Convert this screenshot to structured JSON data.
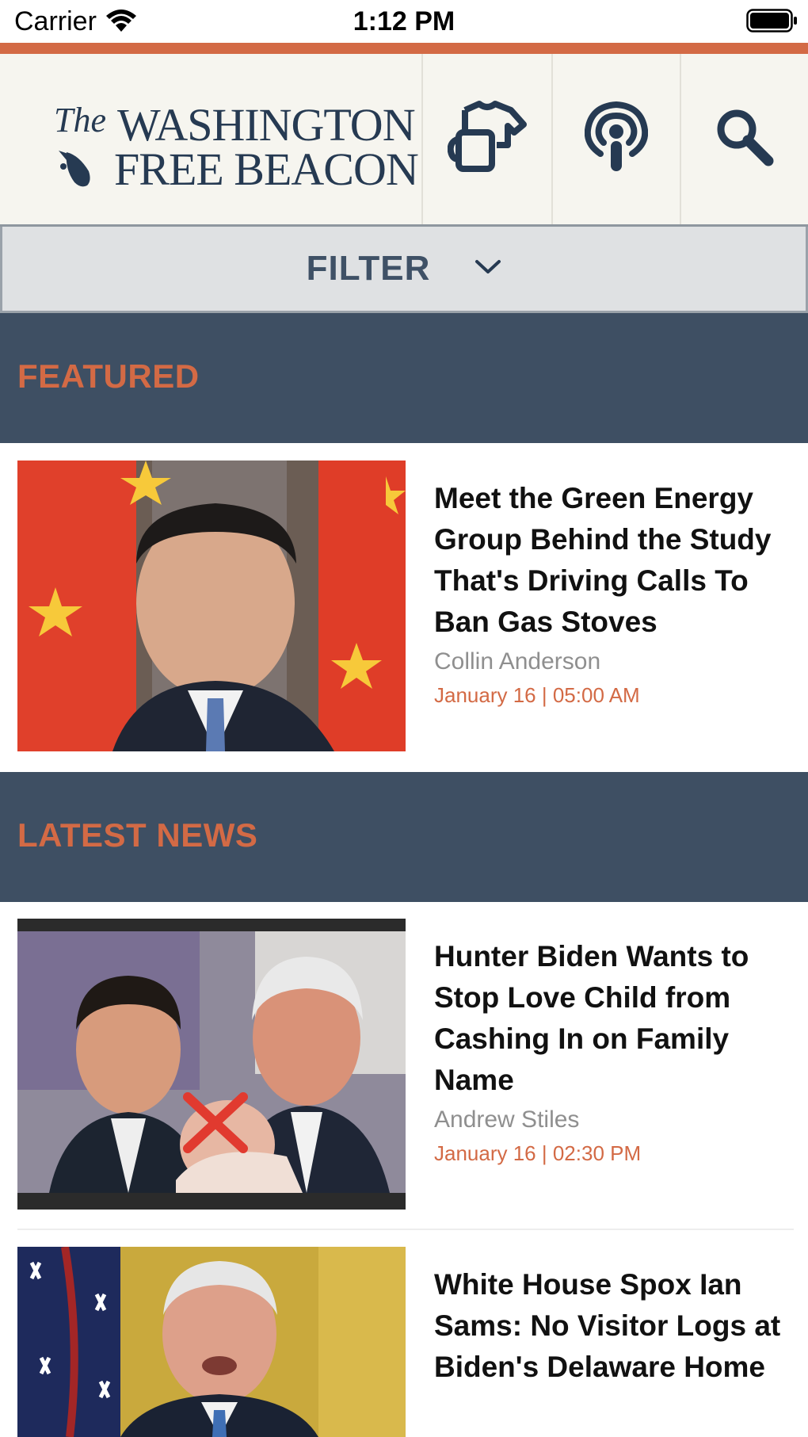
{
  "status_bar": {
    "carrier": "Carrier",
    "time": "1:12 PM",
    "wifi_icon": "wifi-icon",
    "battery_icon": "battery-icon"
  },
  "header": {
    "logo": {
      "the": "The",
      "line1": "WASHINGTON",
      "line2": "FREE BEACON"
    },
    "icons": [
      "shop-icon",
      "podcast-icon",
      "search-icon"
    ]
  },
  "filter": {
    "label": "FILTER",
    "icon": "chevron-down-icon"
  },
  "sections": {
    "featured": {
      "title": "FEATURED"
    },
    "latest": {
      "title": "LATEST NEWS"
    }
  },
  "featured_article": {
    "headline": "Meet the Green Energy Group Behind the Study That's Driving Calls To Ban Gas Stoves",
    "author": "Collin Anderson",
    "date": "January 16 | 05:00 AM"
  },
  "latest_articles": [
    {
      "headline": "Hunter Biden Wants to Stop Love Child from Cashing In on Family Name",
      "author": "Andrew Stiles",
      "date": "January 16 | 02:30 PM"
    },
    {
      "headline": "White House Spox Ian Sams: No Visitor Logs at Biden's Delaware Home"
    }
  ],
  "colors": {
    "accent": "#d36a45",
    "navy": "#3e4f63",
    "logo": "#263a52",
    "header_bg": "#f6f5ef",
    "filter_bg": "#dfe1e3"
  }
}
